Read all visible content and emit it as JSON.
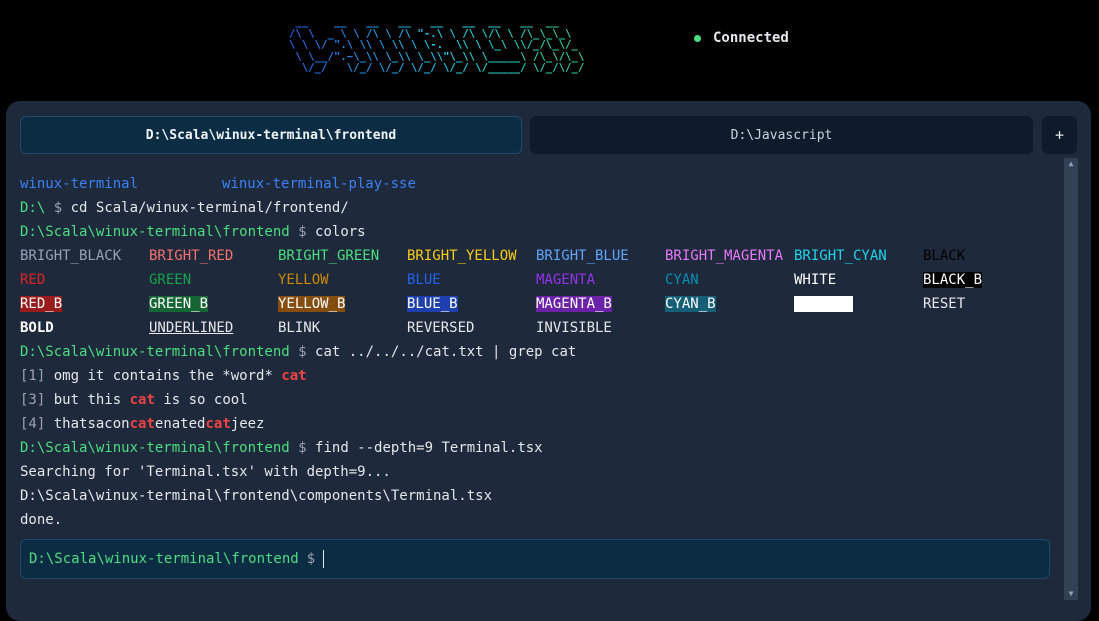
{
  "header": {
    "logo_ascii": " __    __   __   __   __   __  __   __  __\n/\\ \\  _ \\ \\ /\\ \\ /\\ \"-.\\ \\ /\\ \\/\\ \\ /\\_\\_\\_\\\n\\ \\ \\/ \".\\ \\\\ \\ \\\\ \\ \\-.  \\\\ \\ \\_\\ \\\\/_/\\_\\/_\n \\ \\__/\".~\\_\\\\ \\_\\\\ \\_\\\\\"\\_\\\\ \\_____\\ /\\_\\/\\_\\\n  \\/_/   \\/_/ \\/_/ \\/_/ \\/_/ \\/_____/ \\/_/\\/_/",
    "status_label": "Connected",
    "status_color": "#4ade80"
  },
  "tabs": [
    {
      "label": "D:\\Scala\\winux-terminal\\frontend",
      "active": true
    },
    {
      "label": "D:\\Javascript",
      "active": false
    }
  ],
  "add_tab_label": "+",
  "prompt_symbol": "$",
  "output": {
    "ls_entries": [
      "winux-terminal",
      "winux-terminal-play-sse"
    ],
    "cmd1": {
      "path": "D:\\",
      "command": "cd Scala/winux-terminal/frontend/"
    },
    "cmd2": {
      "path": "D:\\Scala\\winux-terminal\\frontend",
      "command": "colors"
    },
    "colors_rows": [
      [
        "BRIGHT_BLACK",
        "BRIGHT_RED",
        "BRIGHT_GREEN",
        "BRIGHT_YELLOW",
        "BRIGHT_BLUE",
        "BRIGHT_MAGENTA",
        "BRIGHT_CYAN",
        "BLACK"
      ],
      [
        "RED",
        "GREEN",
        "YELLOW",
        "BLUE",
        "MAGENTA",
        "CYAN",
        "WHITE",
        "BLACK_B"
      ],
      [
        "RED_B",
        "GREEN_B",
        "YELLOW_B",
        "BLUE_B",
        "MAGENTA_B",
        "CYAN_B",
        "WHITE_B",
        "RESET"
      ],
      [
        "BOLD",
        "UNDERLINED",
        "BLINK",
        "REVERSED",
        "INVISIBLE"
      ]
    ],
    "cmd3": {
      "path": "D:\\Scala\\winux-terminal\\frontend",
      "command": "cat ../../../cat.txt | grep cat"
    },
    "grep_results": [
      {
        "num": "[1]",
        "before": "omg it contains the *word* ",
        "match": "cat",
        "after": ""
      },
      {
        "num": "[3]",
        "before": "but this ",
        "match": "cat",
        "after": " is so cool"
      },
      {
        "num": "[4]",
        "parts": [
          "thatsacon",
          "cat",
          "enated",
          "cat",
          "jeez"
        ]
      }
    ],
    "cmd4": {
      "path": "D:\\Scala\\winux-terminal\\frontend",
      "command": "find --depth=9 Terminal.tsx"
    },
    "find_output": [
      "Searching for 'Terminal.tsx' with depth=9...",
      "D:\\Scala\\winux-terminal\\frontend\\components\\Terminal.tsx",
      "done."
    ]
  },
  "input": {
    "path": "D:\\Scala\\winux-terminal\\frontend",
    "value": ""
  },
  "icons": {
    "status": "status-dot-icon",
    "scroll_up": "scroll-up-arrow-icon",
    "scroll_down": "scroll-down-arrow-icon"
  },
  "colors": {
    "background": "#000000",
    "terminal_bg": "#1e293b",
    "prompt_path": "#4ade80",
    "link": "#3b82f6",
    "grep_highlight": "#ef4444"
  }
}
